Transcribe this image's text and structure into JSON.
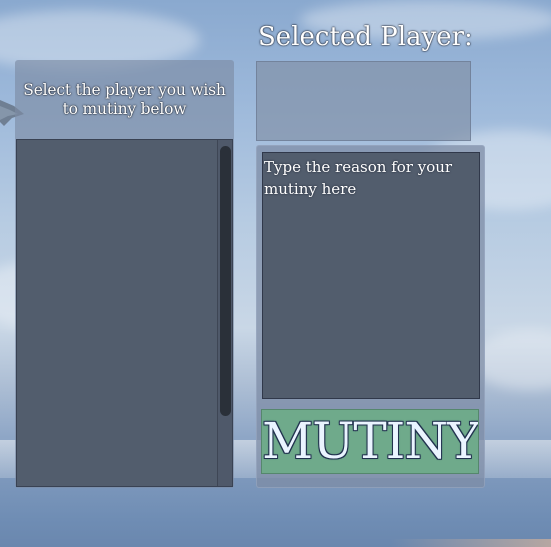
{
  "left_panel": {
    "title": "Select the player you wish to mutiny below",
    "players": []
  },
  "selected_player": {
    "title": "Selected Player:",
    "value": ""
  },
  "reason": {
    "placeholder": "Type the reason for your mutiny here",
    "value": ""
  },
  "mutiny_button": {
    "label": "MUTINY"
  },
  "colors": {
    "panel": "#7d8ca5",
    "list_bg": "#525d6d",
    "button_bg": "#6faa8b",
    "button_text": "#eaf4ff",
    "scroll_thumb": "#2a3039"
  }
}
